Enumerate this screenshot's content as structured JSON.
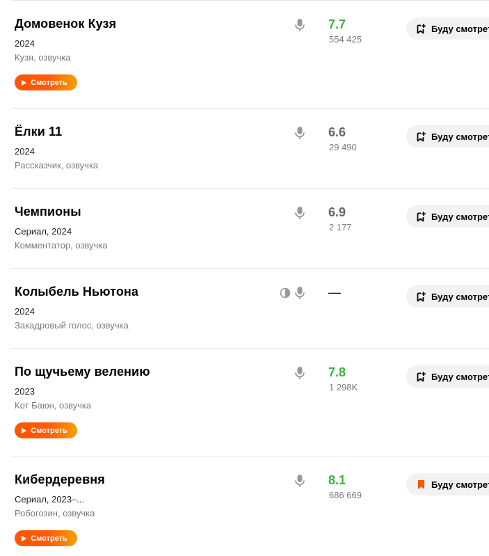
{
  "ui": {
    "watch_label": "Смотреть",
    "future_label": "Буду смотреть",
    "colors": {
      "rating_high": "#3bb33b",
      "rating_mid": "#666666",
      "watch_gradient_start": "#ff5500",
      "watch_gradient_end": "#f5a100",
      "bookmark_active": "#ff5500"
    }
  },
  "items": [
    {
      "title": "Домовенок Кузя",
      "year": "2024",
      "role": "Кузя, озвучка",
      "rating": "7.7",
      "rating_level": "high",
      "votes": "554 425",
      "has_watch_button": true,
      "has_contrast_icon": false,
      "bookmarked": false,
      "icons": [
        "microphone-icon",
        "bookmark-plus-icon",
        "play-icon"
      ]
    },
    {
      "title": "Ёлки 11",
      "year": "2024",
      "role": "Рассказчик, озвучка",
      "rating": "6.6",
      "rating_level": "mid",
      "votes": "29 490",
      "has_watch_button": false,
      "has_contrast_icon": false,
      "bookmarked": false,
      "icons": [
        "microphone-icon",
        "bookmark-plus-icon"
      ]
    },
    {
      "title": "Чемпионы",
      "year": "Сериал, 2024",
      "role": "Комментатор, озвучка",
      "rating": "6.9",
      "rating_level": "mid",
      "votes": "2 177",
      "has_watch_button": false,
      "has_contrast_icon": false,
      "bookmarked": false,
      "icons": [
        "microphone-icon",
        "bookmark-plus-icon"
      ]
    },
    {
      "title": "Колыбель Ньютона",
      "year": "2024",
      "role": "Закадровый голос, озвучка",
      "rating": "—",
      "rating_level": "none",
      "votes": "",
      "has_watch_button": false,
      "has_contrast_icon": true,
      "bookmarked": false,
      "icons": [
        "half-circle-icon",
        "microphone-icon",
        "bookmark-plus-icon"
      ]
    },
    {
      "title": "По щучьему велению",
      "year": "2023",
      "role": "Кот Баюн, озвучка",
      "rating": "7.8",
      "rating_level": "high",
      "votes": "1 298K",
      "has_watch_button": true,
      "has_contrast_icon": false,
      "bookmarked": false,
      "icons": [
        "microphone-icon",
        "bookmark-plus-icon",
        "play-icon"
      ]
    },
    {
      "title": "Кибердеревня",
      "year": "Сериал, 2023–...",
      "role": "Робогозин, озвучка",
      "rating": "8.1",
      "rating_level": "high",
      "votes": "686 669",
      "has_watch_button": true,
      "has_contrast_icon": false,
      "bookmarked": true,
      "icons": [
        "microphone-icon",
        "bookmark-filled-icon",
        "play-icon"
      ]
    }
  ]
}
